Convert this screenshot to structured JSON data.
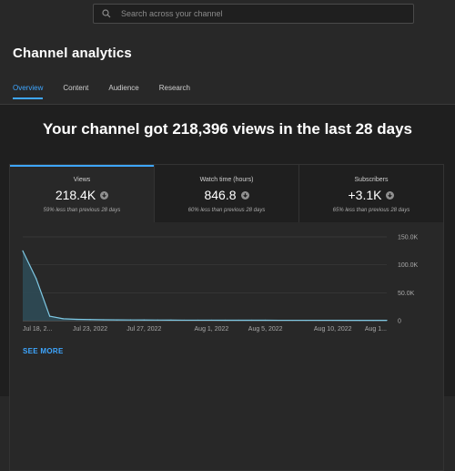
{
  "search": {
    "placeholder": "Search across your channel"
  },
  "page_title": "Channel analytics",
  "tabs": [
    {
      "label": "Overview",
      "active": true
    },
    {
      "label": "Content",
      "active": false
    },
    {
      "label": "Audience",
      "active": false
    },
    {
      "label": "Research",
      "active": false
    }
  ],
  "headline": "Your channel got 218,396 views in the last 28 days",
  "metrics": [
    {
      "label": "Views",
      "value": "218.4K",
      "note": "59% less than previous 28 days",
      "icon": "down-arrow-icon"
    },
    {
      "label": "Watch time (hours)",
      "value": "846.8",
      "note": "60% less than previous 28 days",
      "icon": "down-arrow-icon"
    },
    {
      "label": "Subscribers",
      "value": "+3.1K",
      "note": "65% less than previous 28 days",
      "icon": "down-arrow-icon"
    }
  ],
  "see_more": "SEE MORE",
  "colors": {
    "accent": "#3ea6ff",
    "line": "#7ec8e3",
    "fill": "#2d4a55"
  },
  "chart_data": {
    "type": "area",
    "x": [
      "Jul 18, 2...",
      "Jul 19",
      "Jul 20",
      "Jul 21",
      "Jul 22",
      "Jul 23, 2022",
      "Jul 24",
      "Jul 25",
      "Jul 26",
      "Jul 27, 2022",
      "Jul 28",
      "Jul 29",
      "Jul 30",
      "Jul 31",
      "Aug 1, 2022",
      "Aug 2",
      "Aug 3",
      "Aug 4",
      "Aug 5, 2022",
      "Aug 6",
      "Aug 7",
      "Aug 8",
      "Aug 9",
      "Aug 10, 2022",
      "Aug 11",
      "Aug 12",
      "Aug 13",
      "Aug 1..."
    ],
    "values": [
      125000,
      75000,
      8000,
      3500,
      2500,
      2000,
      1600,
      1400,
      1300,
      1200,
      1100,
      1000,
      950,
      900,
      900,
      850,
      850,
      800,
      800,
      750,
      750,
      700,
      700,
      700,
      650,
      650,
      600,
      600
    ],
    "x_tick_labels": [
      "Jul 18, 2...",
      "Jul 23, 2022",
      "Jul 27, 2022",
      "Aug 1, 2022",
      "Aug 5, 2022",
      "Aug 10, 2022",
      "Aug 1..."
    ],
    "y_tick_labels": [
      "150.0K",
      "100.0K",
      "50.0K",
      "0"
    ],
    "y_ticks": [
      150000,
      100000,
      50000,
      0
    ],
    "ylim": [
      0,
      150000
    ],
    "grid": true
  }
}
